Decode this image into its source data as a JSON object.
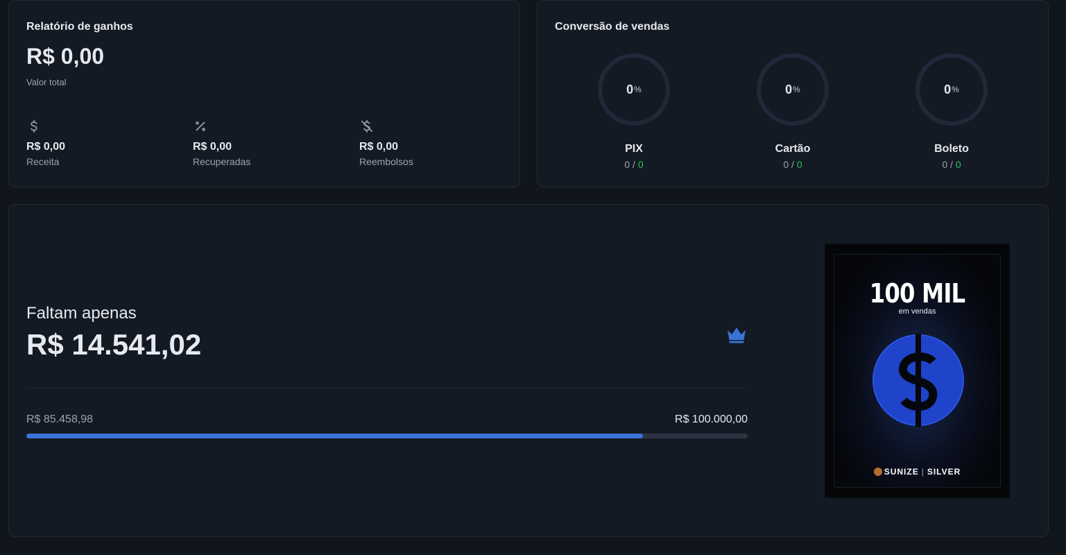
{
  "earnings": {
    "title": "Relatório de ganhos",
    "total": "R$ 0,00",
    "total_label": "Valor total",
    "stats": [
      {
        "icon": "dollar-icon",
        "value": "R$ 0,00",
        "label": "Receita"
      },
      {
        "icon": "percent-icon",
        "value": "R$ 0,00",
        "label": "Recuperadas"
      },
      {
        "icon": "dollar-off-icon",
        "value": "R$ 0,00",
        "label": "Reembolsos"
      }
    ]
  },
  "conversion": {
    "title": "Conversão de vendas",
    "methods": [
      {
        "name": "PIX",
        "percent": "0",
        "pct_sign": "%",
        "done": "0",
        "sep": " / ",
        "total": "0"
      },
      {
        "name": "Cartão",
        "percent": "0",
        "pct_sign": "%",
        "done": "0",
        "sep": " / ",
        "total": "0"
      },
      {
        "name": "Boleto",
        "percent": "0",
        "pct_sign": "%",
        "done": "0",
        "sep": " / ",
        "total": "0"
      }
    ]
  },
  "goal": {
    "label": "Faltam apenas",
    "remaining": "R$ 14.541,02",
    "current": "R$ 85.458,98",
    "target": "R$ 100.000,00",
    "progress_fraction": 0.8546,
    "icon": "crown-icon",
    "plaque": {
      "title": "100 MIL",
      "subtitle": "em vendas",
      "brand_name": "SUNIZE",
      "brand_sep": "|",
      "brand_tier": "SILVER"
    }
  },
  "colors": {
    "background": "#11151c",
    "card": "#141a24",
    "accent_blue": "#3a73d6",
    "success_green": "#22c55e",
    "muted_text": "#9aa3b2"
  }
}
